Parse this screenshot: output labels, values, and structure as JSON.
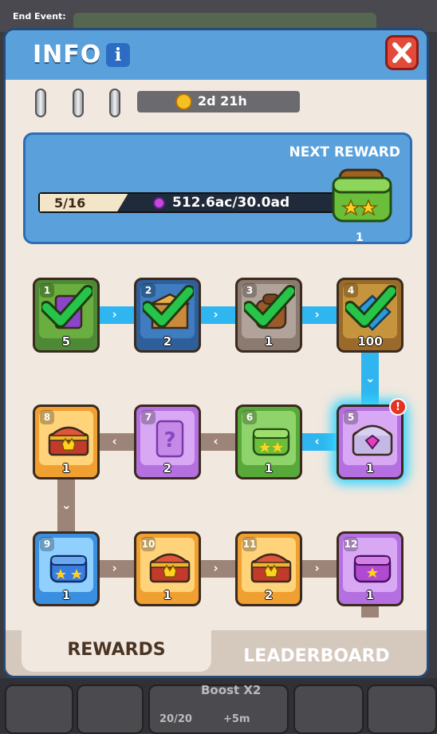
{
  "background": {
    "end_event_label": "End Event:",
    "dock": {
      "boost_label": "Boost X2",
      "boost_count": "20/20",
      "boost_time": "+5m"
    }
  },
  "panel": {
    "title": "INFO",
    "info_badge": "i",
    "close_icon": "close-x-icon"
  },
  "timer": {
    "text": "2d 21h",
    "icon": "clock-icon"
  },
  "progress": {
    "next_reward_label": "NEXT REWARD",
    "count": "5/16",
    "value": "512.6ac/30.0ad",
    "fill_fraction": 0.3,
    "next_reward_count": "1",
    "next_reward_icon": "green-backpack-icon"
  },
  "nodes": [
    {
      "num": "1",
      "count": "5",
      "bg": "#4e8a35",
      "inner": "#6aae3f",
      "art": "ticket",
      "claimed": true
    },
    {
      "num": "2",
      "count": "2",
      "bg": "#2f5f9a",
      "inner": "#3f7cc0",
      "art": "crate",
      "claimed": true
    },
    {
      "num": "3",
      "count": "1",
      "bg": "#8a7a70",
      "inner": "#b1a39a",
      "art": "brown-bag",
      "claimed": true
    },
    {
      "num": "4",
      "count": "100",
      "bg": "#9a6a2a",
      "inner": "#c7943e",
      "art": "blue-gem",
      "claimed": true
    },
    {
      "num": "5",
      "count": "1",
      "bg": "#b46fe0",
      "inner": "#d9a8f5",
      "art": "silver-chest",
      "claimed": false,
      "current": true
    },
    {
      "num": "6",
      "count": "1",
      "bg": "#58a83a",
      "inner": "#8fd46a",
      "art": "green-bag",
      "claimed": false
    },
    {
      "num": "7",
      "count": "2",
      "bg": "#b46fe0",
      "inner": "#d9a8f5",
      "art": "mystery-card",
      "claimed": false
    },
    {
      "num": "8",
      "count": "1",
      "bg": "#f0a030",
      "inner": "#ffd37a",
      "art": "gold-chest",
      "claimed": false
    },
    {
      "num": "9",
      "count": "1",
      "bg": "#3a8fe0",
      "inner": "#8fd0ff",
      "art": "blue-bag",
      "claimed": false
    },
    {
      "num": "10",
      "count": "1",
      "bg": "#f0a030",
      "inner": "#ffd37a",
      "art": "gold-chest",
      "claimed": false
    },
    {
      "num": "11",
      "count": "2",
      "bg": "#f0a030",
      "inner": "#ffd37a",
      "art": "gold-chest",
      "claimed": false
    },
    {
      "num": "12",
      "count": "1",
      "bg": "#b46fe0",
      "inner": "#d9a8f5",
      "art": "purple-bag",
      "claimed": false
    }
  ],
  "alert": "!",
  "tabs": {
    "rewards": "REWARDS",
    "leaderboard": "LEADERBOARD"
  }
}
